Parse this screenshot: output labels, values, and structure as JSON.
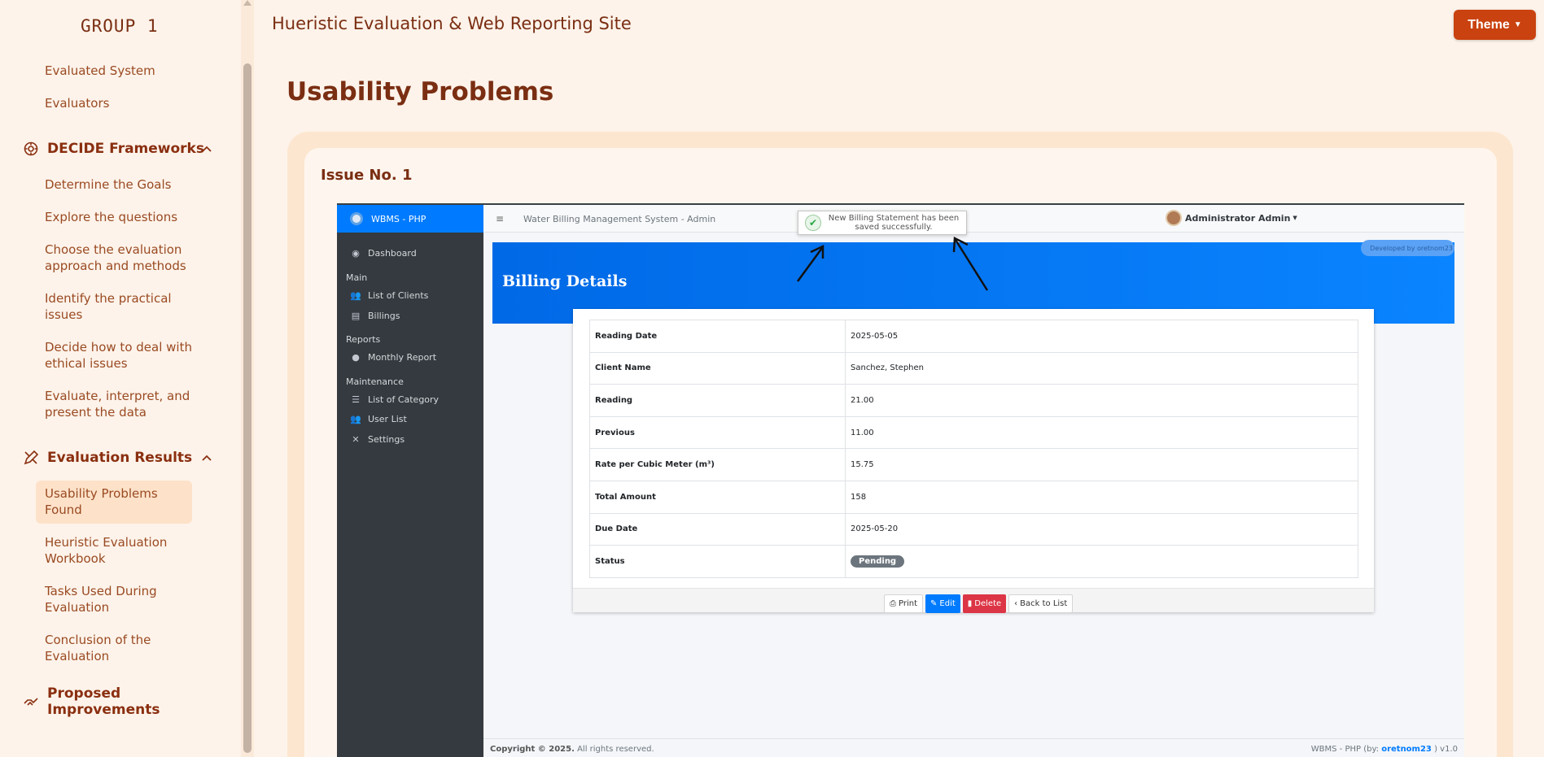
{
  "sidebar": {
    "brand": "GROUP 1",
    "top_items": [
      "Evaluated System",
      "Evaluators"
    ],
    "decide": {
      "label": "DECIDE Frameworks",
      "items": [
        "Determine the Goals",
        "Explore the questions",
        "Choose the evaluation approach and methods",
        "Identify the practical issues",
        "Decide how to deal with ethical issues",
        "Evaluate, interpret, and present the data"
      ]
    },
    "results": {
      "label": "Evaluation Results",
      "items": [
        "Usability Problems Found",
        "Heuristic Evaluation Workbook",
        "Tasks Used During Evaluation",
        "Conclusion of the Evaluation"
      ]
    },
    "improvements": {
      "label": "Proposed Improvements"
    }
  },
  "header": {
    "title": "Hueristic Evaluation & Web Reporting Site",
    "theme_button": "Theme"
  },
  "main": {
    "page_title": "Usability Problems",
    "issue_title": "Issue No. 1"
  },
  "screenshot": {
    "brand": "WBMS - PHP",
    "app_title": "Water Billing Management System - Admin",
    "user": "Administrator Admin",
    "toast": "New Billing Statement has been saved successfully.",
    "nav": {
      "dashboard": "Dashboard",
      "main_group": "Main",
      "clients": "List of Clients",
      "billings": "Billings",
      "reports_group": "Reports",
      "monthly": "Monthly Report",
      "maintenance_group": "Maintenance",
      "category": "List of Category",
      "users": "User List",
      "settings": "Settings"
    },
    "banner_title": "Billing Details",
    "developed_by": "Developed by oretnom23",
    "details": [
      {
        "label": "Reading Date",
        "value": "2025-05-05"
      },
      {
        "label": "Client Name",
        "value": "Sanchez, Stephen"
      },
      {
        "label": "Reading",
        "value": "21.00"
      },
      {
        "label": "Previous",
        "value": "11.00"
      },
      {
        "label": "Rate per Cubic Meter (m³)",
        "value": "15.75"
      },
      {
        "label": "Total Amount",
        "value": "158"
      },
      {
        "label": "Due Date",
        "value": "2025-05-20"
      },
      {
        "label": "Status",
        "value": "Pending"
      }
    ],
    "buttons": {
      "print": "Print",
      "edit": "Edit",
      "delete": "Delete",
      "back": "Back to List"
    },
    "copyright_bold": "Copyright © 2025.",
    "copyright_rest": " All rights reserved.",
    "version_prefix": "WBMS - PHP (by: ",
    "version_link": "oretnom23",
    "version_suffix": " ) v1.0"
  }
}
